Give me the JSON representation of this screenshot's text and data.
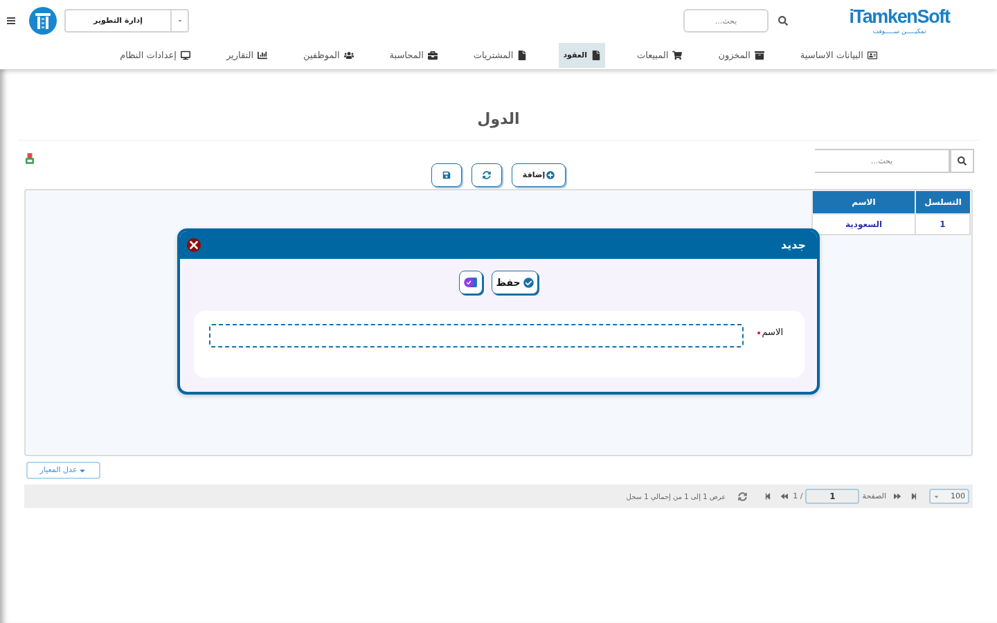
{
  "header": {
    "brand": {
      "name": "iTamkenSoft",
      "tagline": "تمكيـــــن ســـــوفت"
    },
    "search": {
      "placeholder": "بحث..."
    },
    "department_select": {
      "value": "إدارة التطوير"
    },
    "nav": [
      {
        "label": "البيانات الاساسية",
        "selected": false
      },
      {
        "label": "المخزون",
        "selected": false
      },
      {
        "label": "المبيعات",
        "selected": false
      },
      {
        "label": "العقود",
        "selected": true
      },
      {
        "label": "المشتريات",
        "selected": false
      },
      {
        "label": "المحاسبة",
        "selected": false
      },
      {
        "label": "الموظفين",
        "selected": false
      },
      {
        "label": "التقارير",
        "selected": false
      },
      {
        "label": "إعدادات النظام",
        "selected": false
      }
    ]
  },
  "page": {
    "title": "الدول",
    "search": {
      "placeholder": "بحث..."
    },
    "toolbar": {
      "add_button": "إضافة"
    },
    "table": {
      "columns": [
        "التسلسل",
        "الاسم"
      ],
      "rows": [
        [
          "1",
          "السعودية"
        ]
      ]
    },
    "filter_button": "عدل المعيار",
    "pagination": {
      "page_size": "100",
      "page_label": "الصفحة",
      "page": "1",
      "page_count": "/ 1",
      "summary": "عرض 1 إلى 1 من إجمالي 1 سجل"
    }
  },
  "dialog": {
    "title": "جديد",
    "save_button": "حفظ",
    "field": {
      "label": "الاسم",
      "required": true
    }
  }
}
